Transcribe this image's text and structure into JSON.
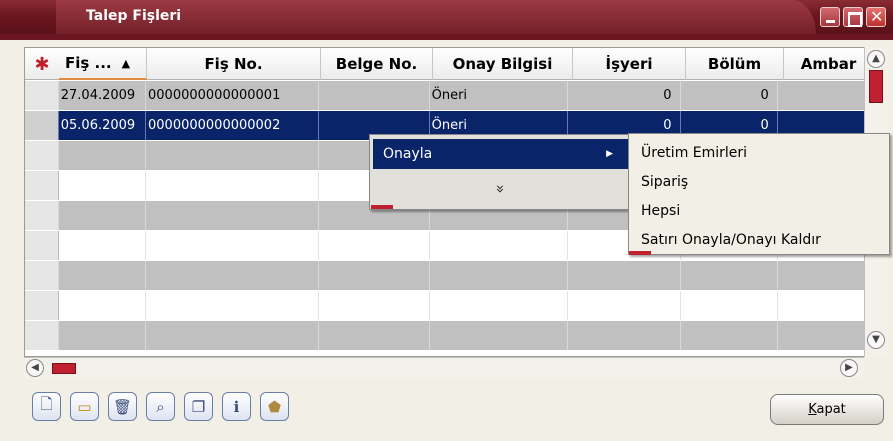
{
  "window": {
    "title": "Talep Fişleri"
  },
  "grid": {
    "columns": [
      {
        "label": "Fiş ...",
        "sorted": true
      },
      {
        "label": "Fiş No."
      },
      {
        "label": "Belge No."
      },
      {
        "label": "Onay Bilgisi"
      },
      {
        "label": "İşyeri"
      },
      {
        "label": "Bölüm"
      },
      {
        "label": "Ambar"
      }
    ],
    "rows": [
      {
        "date": "27.04.2009",
        "fis_no": "0000000000000001",
        "belge_no": "",
        "onay": "Öneri",
        "isyeri": "0",
        "bolum": "0",
        "ambar": ""
      },
      {
        "date": "05.06.2009",
        "fis_no": "0000000000000002",
        "belge_no": "",
        "onay": "Öneri",
        "isyeri": "0",
        "bolum": "0",
        "ambar": ""
      }
    ]
  },
  "context_menu": {
    "item": "Onayla",
    "more_glyph": "»",
    "submenu": [
      "Üretim Emirleri",
      "Sipariş",
      "Hepsi",
      "Satırı Onayla/Onayı Kaldır"
    ]
  },
  "toolbar": {
    "icons": [
      "new-document-icon",
      "open-folder-icon",
      "delete-trash-icon",
      "preview-search-icon",
      "copy-icon",
      "info-icon",
      "shield-icon"
    ]
  },
  "close_button": {
    "label_underlined": "K",
    "label_rest": "apat"
  }
}
